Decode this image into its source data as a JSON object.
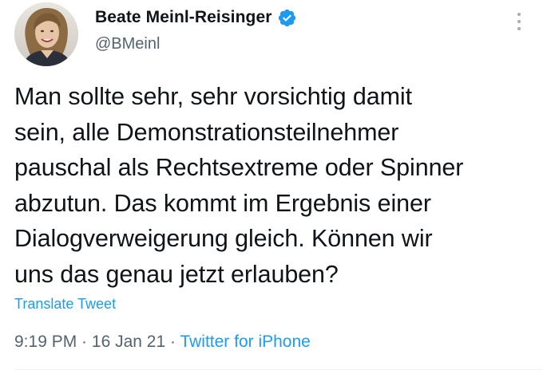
{
  "author": {
    "display_name": "Beate Meinl-Reisinger",
    "handle": "@BMeinl",
    "verified": true
  },
  "tweet": {
    "text": "Man sollte sehr, sehr vorsichtig damit\nsein, alle Demonstrationsteilnehmer\npauschal als Rechtsextreme oder Spinner\nabzutun. Das kommt im Ergebnis einer\nDialogverweigerung gleich. Können wir\nuns das genau jetzt erlauben?",
    "translate_label": "Translate Tweet"
  },
  "meta": {
    "time": "9:19 PM",
    "separator": " · ",
    "date": "16 Jan 21",
    "source": "Twitter for iPhone"
  },
  "icons": {
    "verified": "verified-badge-icon",
    "more": "more-dots-icon"
  },
  "colors": {
    "accent": "#1d9bf0",
    "text_primary": "#0f1419",
    "text_secondary": "#536471"
  }
}
